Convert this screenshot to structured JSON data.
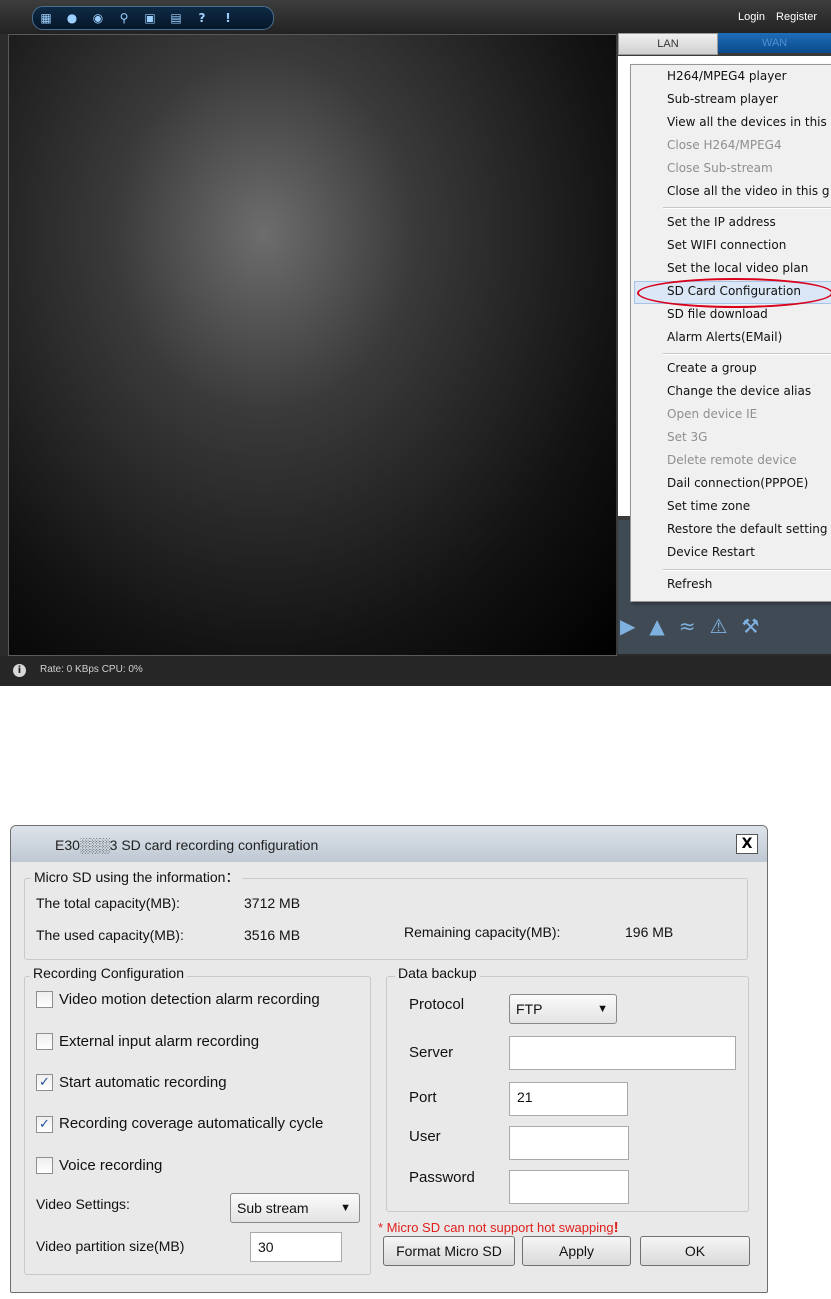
{
  "app": {
    "toolbar_icons": [
      "grid-icon",
      "settings-icon",
      "camera-icon",
      "search-icon",
      "lock-icon",
      "save-icon",
      "help-icon",
      "alert-icon"
    ],
    "login_label": "Login",
    "register_label": "Register",
    "tabs": {
      "lan": "LAN",
      "wan": "WAN"
    },
    "status_text": "Rate: 0 KBps CPU:  0%",
    "context_menu": {
      "items": [
        {
          "label": "H264/MPEG4 player",
          "enabled": true
        },
        {
          "label": "Sub-stream player",
          "enabled": true
        },
        {
          "label": "View all the devices in this g",
          "enabled": true
        },
        {
          "label": "Close H264/MPEG4",
          "enabled": false
        },
        {
          "label": "Close Sub-stream",
          "enabled": false
        },
        {
          "label": "Close all the video in this g",
          "enabled": true
        },
        {
          "label": "Set the IP address",
          "enabled": true
        },
        {
          "label": "Set WIFI connection",
          "enabled": true
        },
        {
          "label": "Set the local video plan",
          "enabled": true
        },
        {
          "label": "SD Card Configuration",
          "enabled": true,
          "highlighted": true
        },
        {
          "label": "SD file download",
          "enabled": true
        },
        {
          "label": "Alarm Alerts(EMail)",
          "enabled": true
        },
        {
          "label": "Create a group",
          "enabled": true
        },
        {
          "label": "Change the device alias",
          "enabled": true
        },
        {
          "label": "Open device IE",
          "enabled": false
        },
        {
          "label": "Set 3G",
          "enabled": false
        },
        {
          "label": "Delete remote device",
          "enabled": false
        },
        {
          "label": "Dail connection(PPPOE)",
          "enabled": true
        },
        {
          "label": "Set time zone",
          "enabled": true
        },
        {
          "label": "Restore the default setting",
          "enabled": true
        },
        {
          "label": "Device Restart",
          "enabled": true
        },
        {
          "label": "Refresh",
          "enabled": true
        }
      ],
      "highlight_color": "#d9001b"
    }
  },
  "dialog": {
    "title": "E30░░░3 SD card recording configuration",
    "close_label": "X",
    "info": {
      "group_label": "Micro SD using the information：",
      "total_label": "The total capacity(MB):",
      "total_value": "3712 MB",
      "used_label": "The used capacity(MB):",
      "used_value": "3516 MB",
      "remaining_label": "Remaining capacity(MB):",
      "remaining_value": "196 MB"
    },
    "recording": {
      "group_label": "Recording Configuration",
      "options": [
        {
          "label": "Video motion detection alarm recording",
          "checked": false
        },
        {
          "label": "External input alarm recording",
          "checked": false
        },
        {
          "label": "Start automatic recording",
          "checked": true
        },
        {
          "label": "Recording coverage automatically cycle",
          "checked": true
        },
        {
          "label": "Voice recording",
          "checked": false
        }
      ],
      "video_settings_label": "Video Settings:",
      "video_settings_value": "Sub stream",
      "partition_label": "Video partition size(MB)",
      "partition_value": "30"
    },
    "backup": {
      "group_label": "Data backup",
      "protocol_label": "Protocol",
      "protocol_value": "FTP",
      "server_label": "Server",
      "server_value": "",
      "port_label": "Port",
      "port_value": "21",
      "user_label": "User",
      "user_value": "",
      "password_label": "Password",
      "password_value": ""
    },
    "warning_text": "* Micro SD can not support hot swapping",
    "warning_bang": "!",
    "buttons": {
      "format": "Format Micro SD",
      "apply": "Apply",
      "ok": "OK"
    }
  }
}
